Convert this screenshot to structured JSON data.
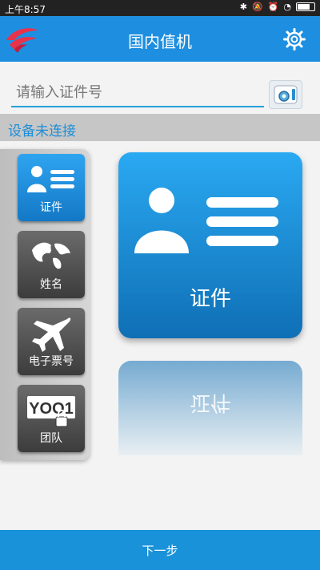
{
  "status_bar": {
    "time": "上午8:57"
  },
  "header": {
    "title": "国内值机"
  },
  "search": {
    "placeholder": "请输入证件号",
    "value": ""
  },
  "connection_status": "设备未连接",
  "tabs": [
    {
      "label": "证件",
      "icon": "id-card-icon",
      "active": true
    },
    {
      "label": "姓名",
      "icon": "globe-icon",
      "active": false
    },
    {
      "label": "电子票号",
      "icon": "airplane-icon",
      "active": false
    },
    {
      "label": "团队",
      "icon": "team-lock-icon",
      "active": false
    }
  ],
  "card": {
    "label": "证件",
    "icon": "id-card-icon"
  },
  "reflection_label": "证件",
  "footer": {
    "next_label": "下一步"
  },
  "colors": {
    "primary": "#1e8fe0",
    "active_tab": "#2fa4f0",
    "inactive_tab": "#4a4a4a",
    "status_text": "#1d8ed7"
  },
  "tab_icon_text": {
    "team": "YOO1"
  }
}
